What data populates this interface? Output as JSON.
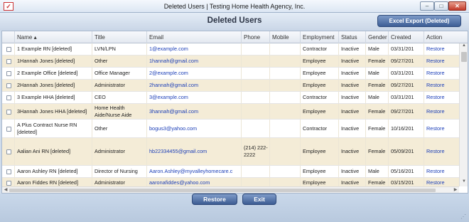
{
  "window": {
    "title": "Deleted Users | Testing Home Health Agency, Inc.",
    "app_icon_glyph": "✓",
    "buttons": [
      "–",
      "□",
      "✕"
    ]
  },
  "page": {
    "title": "Deleted Users",
    "excel_export_label": "Excel Export (Deleted)"
  },
  "columns": [
    {
      "label": "Name ▴"
    },
    {
      "label": "Title"
    },
    {
      "label": "Email"
    },
    {
      "label": "Phone"
    },
    {
      "label": "Mobile"
    },
    {
      "label": "Employment"
    },
    {
      "label": "Status"
    },
    {
      "label": "Gender"
    },
    {
      "label": "Created"
    },
    {
      "label": "Action"
    }
  ],
  "rows": [
    {
      "name": "1 Example RN [deleted]",
      "title": "LVN/LPN",
      "email": "1@example.com",
      "phone": "",
      "mobile": "",
      "employment": "Contractor",
      "status": "Inactive",
      "gender": "Male",
      "created": "03/31/201",
      "action": "Restore"
    },
    {
      "name": "1Hannah Jones [deleted]",
      "title": "Other",
      "email": "1hannah@gmail.com",
      "phone": "",
      "mobile": "",
      "employment": "Employee",
      "status": "Inactive",
      "gender": "Female",
      "created": "09/27/201",
      "action": "Restore"
    },
    {
      "name": "2 Example Office [deleted]",
      "title": "Office Manager",
      "email": "2@example.com",
      "phone": "",
      "mobile": "",
      "employment": "Employee",
      "status": "Inactive",
      "gender": "Male",
      "created": "03/31/201",
      "action": "Restore"
    },
    {
      "name": "2Hannah Jones [deleted]",
      "title": "Administrator",
      "email": "2hannah@gmail.com",
      "phone": "",
      "mobile": "",
      "employment": "Employee",
      "status": "Inactive",
      "gender": "Female",
      "created": "09/27/201",
      "action": "Restore"
    },
    {
      "name": "3 Example HHA [deleted]",
      "title": "CEO",
      "email": "3@example.com",
      "phone": "",
      "mobile": "",
      "employment": "Contractor",
      "status": "Inactive",
      "gender": "Male",
      "created": "03/31/201",
      "action": "Restore"
    },
    {
      "name": "3Hannah Jones HHA [deleted]",
      "title": "Home Health Aide/Nurse Aide",
      "email": "3hannah@gmail.com",
      "phone": "",
      "mobile": "",
      "employment": "Employee",
      "status": "Inactive",
      "gender": "Female",
      "created": "09/27/201",
      "action": "Restore"
    },
    {
      "name": "A Plus Contract Nurse RN [deleted]",
      "title": "Other",
      "email": "bogus3@yahoo.com",
      "phone": "",
      "mobile": "",
      "employment": "Contractor",
      "status": "Inactive",
      "gender": "Female",
      "created": "10/16/201",
      "action": "Restore"
    },
    {
      "name": "Aalian Ani RN [deleted]",
      "title": "Administrator",
      "email": "hb22334455@gmail.com",
      "phone": "(214) 222-2222",
      "mobile": "",
      "employment": "Employee",
      "status": "Inactive",
      "gender": "Female",
      "created": "05/09/201",
      "action": "Restore"
    },
    {
      "name": "Aaron Ashley RN [deleted]",
      "title": "Director of Nursing",
      "email": "Aaron.Ashley@myvalleyhomecare.c",
      "phone": "",
      "mobile": "",
      "employment": "Employee",
      "status": "Inactive",
      "gender": "Male",
      "created": "05/16/201",
      "action": "Restore"
    },
    {
      "name": "Aaron Fiddes RN [deleted]",
      "title": "Administrator",
      "email": "aaronafiddes@yahoo.com",
      "phone": "",
      "mobile": "",
      "employment": "Employee",
      "status": "Inactive",
      "gender": "Female",
      "created": "03/15/201",
      "action": "Restore"
    }
  ],
  "footer": {
    "restore_label": "Restore",
    "exit_label": "Exit"
  },
  "icons": {
    "grip": "⋰",
    "up": "▲",
    "down": "▼",
    "left": "◀",
    "right": "▶"
  },
  "colors": {
    "link": "#1c3fb8",
    "row_alt": "#f4ecd7",
    "button": "#3c5c93"
  }
}
